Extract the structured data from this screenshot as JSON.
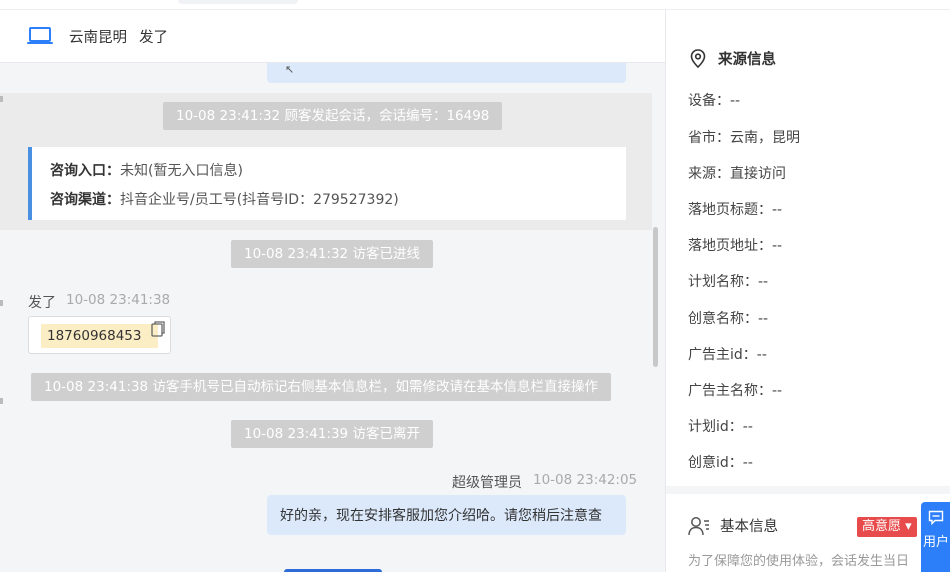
{
  "chat": {
    "header_location": "云南昆明",
    "header_name": "发了",
    "system_messages": [
      "10-08 23:41:32 顾客发起会话，会话编号：16498",
      "10-08 23:41:32 访客已进线",
      "10-08 23:41:38 访客手机号已自动标记右侧基本信息栏，如需修改请在基本信息栏直接操作",
      "10-08 23:41:39 访客已离开"
    ],
    "entry": {
      "label1": "咨询入口：",
      "value1": "未知(暂无入口信息)",
      "label2": "咨询渠道：",
      "value2": "抖音企业号/员工号(抖音号ID：279527392)"
    },
    "visitor_message": {
      "name": "发了",
      "time": "10-08 23:41:38",
      "phone": "18760968453"
    },
    "agent_message": {
      "name": "超级管理员",
      "time": "10-08 23:42:05",
      "text": "好的亲，现在安排客服加您介绍哈。请您稍后注意查"
    }
  },
  "source_info": {
    "title": "来源信息",
    "rows": [
      "设备：--",
      "省市：云南，昆明",
      "来源：直接访问",
      "落地页标题：--",
      "落地页地址：--",
      "计划名称：--",
      "创意名称：--",
      "广告主id：--",
      "广告主名称：--",
      "计划id：--",
      "创意id：--"
    ]
  },
  "basic_info": {
    "title": "基本信息",
    "intent_badge": "高意愿",
    "notice": "为了保障您的使用体验，会话发生当日"
  },
  "side_tab": {
    "label": "用户"
  },
  "colors": {
    "accent": "#2d7ff9",
    "badge": "#e84b4b",
    "bubble": "#dbe9fb",
    "system": "#cfcfcf"
  }
}
